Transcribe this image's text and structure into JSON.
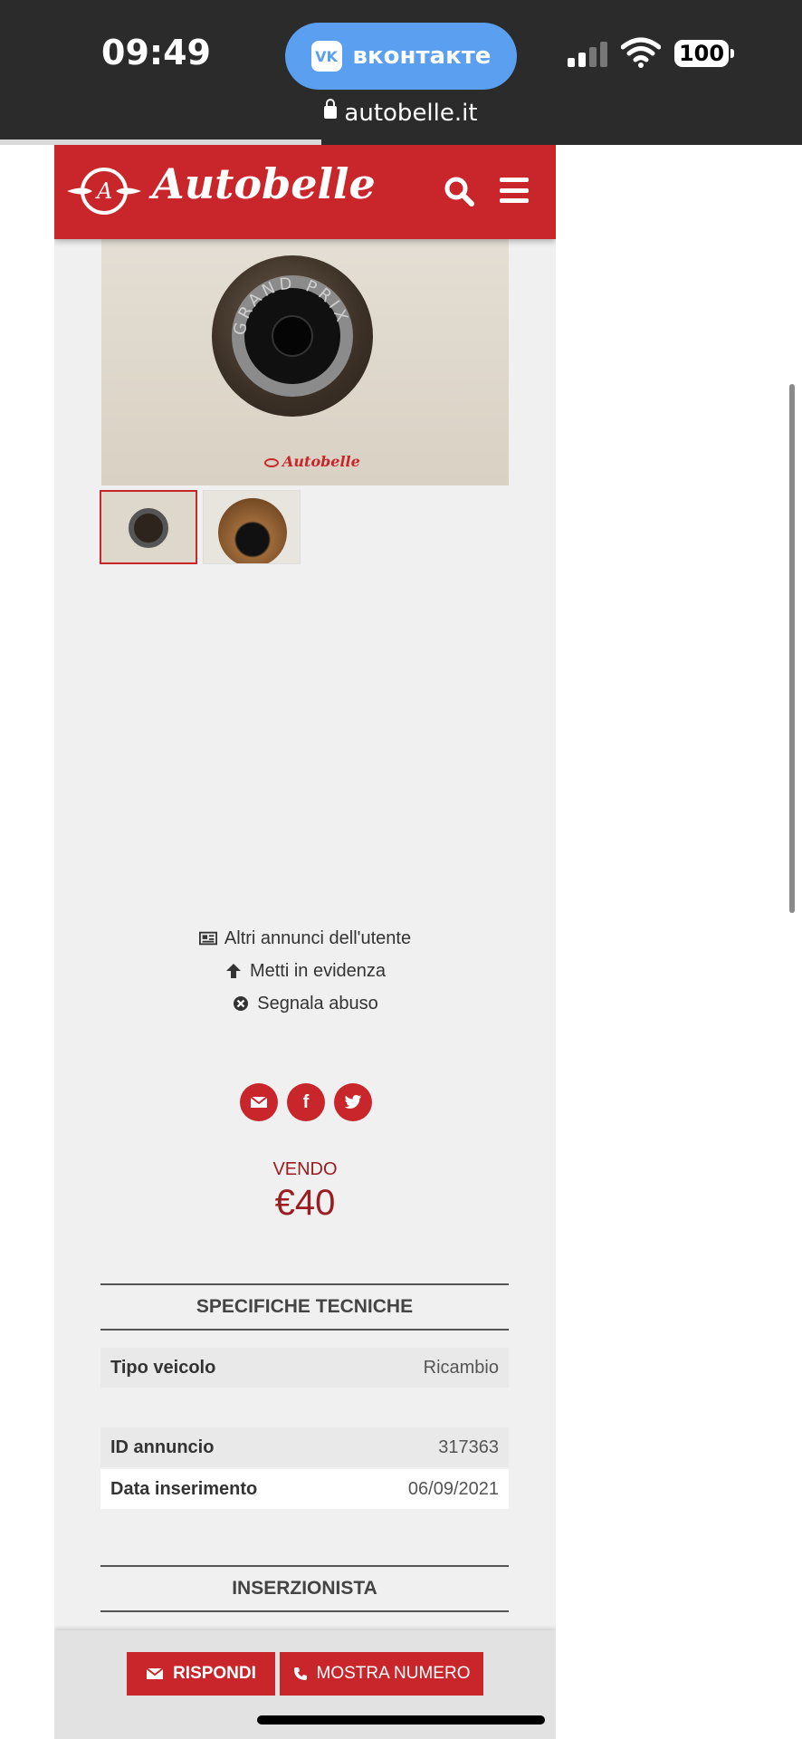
{
  "status_bar": {
    "time": "09:49",
    "vk_label": "вконтакте",
    "vk_logo": "VK",
    "battery": "100",
    "url": "autobelle.it"
  },
  "header": {
    "logo_text": "Autobelle",
    "brand_color": "#c9262c"
  },
  "gallery": {
    "watermark": "Autobelle",
    "thumbnails": 2,
    "knob_text": "GRAND PRIX"
  },
  "links": {
    "other_ads": "Altri annunci dell'utente",
    "highlight": "Metti in evidenza",
    "report": "Segnala abuso"
  },
  "share": {
    "email_icon": "envelope-icon",
    "facebook": "f",
    "twitter_icon": "twitter-icon"
  },
  "listing": {
    "type_label": "VENDO",
    "price": "€40"
  },
  "specs": {
    "title": "SPECIFICHE TECNICHE",
    "rows": [
      {
        "key": "Tipo veicolo",
        "value": "Ricambio"
      },
      {
        "key": "ID annuncio",
        "value": "317363"
      },
      {
        "key": "Data inserimento",
        "value": "06/09/2021"
      }
    ]
  },
  "advertiser": {
    "title": "INSERZIONISTA"
  },
  "actions": {
    "reply": "RISPONDI",
    "show_number": "MOSTRA NUMERO"
  }
}
